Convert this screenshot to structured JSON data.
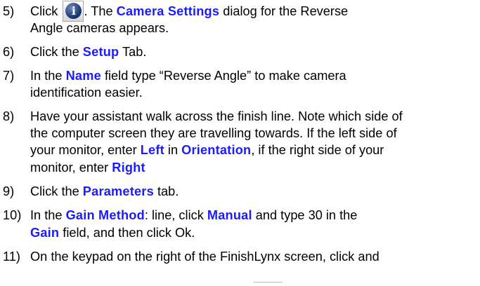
{
  "steps": [
    {
      "num": "5)",
      "lines": [
        [
          {
            "t": "Click "
          },
          {
            "icon": "info-icon"
          },
          {
            "t": ". The "
          },
          {
            "k": "Camera Settings"
          },
          {
            "t": " dialog for the Reverse"
          }
        ],
        [
          {
            "t": "Angle cameras appears."
          }
        ]
      ]
    },
    {
      "num": "6)",
      "lines": [
        [
          {
            "t": "Click the "
          },
          {
            "k": "Setup"
          },
          {
            "t": " Tab."
          }
        ]
      ]
    },
    {
      "num": "7)",
      "lines": [
        [
          {
            "t": "In the "
          },
          {
            "k": "Name"
          },
          {
            "t": " field type “Reverse Angle” to make camera"
          }
        ],
        [
          {
            "t": "identification easier."
          }
        ]
      ]
    },
    {
      "num": "8)",
      "lines": [
        [
          {
            "t": "Have your assistant walk across the finish line. Note which side of"
          }
        ],
        [
          {
            "t": "the computer screen they are travelling towards. If the left side of"
          }
        ],
        [
          {
            "t": "your monitor, enter "
          },
          {
            "k": "Left"
          },
          {
            "t": " in "
          },
          {
            "k": "Orientation"
          },
          {
            "t": ", if the right side of your"
          }
        ],
        [
          {
            "t": "monitor, enter "
          },
          {
            "k": "Right"
          }
        ]
      ]
    },
    {
      "num": "9)",
      "lines": [
        [
          {
            "t": "Click the "
          },
          {
            "k": "Parameters"
          },
          {
            "t": " tab."
          }
        ]
      ]
    },
    {
      "num": "10)",
      "lines": [
        [
          {
            "t": "In the "
          },
          {
            "k": "Gain Method"
          },
          {
            "t": ": line, click "
          },
          {
            "k": "Manual"
          },
          {
            "t": " and type 30 in the"
          }
        ],
        [
          {
            "k": "Gain"
          },
          {
            "t": " field, and then click Ok."
          }
        ]
      ]
    },
    {
      "num": "11)",
      "lines": [
        [
          {
            "t": "On the keypad on the right of the FinishLynx screen, click and"
          }
        ]
      ]
    }
  ],
  "colors": {
    "keyword": "#1b1bff",
    "text": "#000000"
  }
}
